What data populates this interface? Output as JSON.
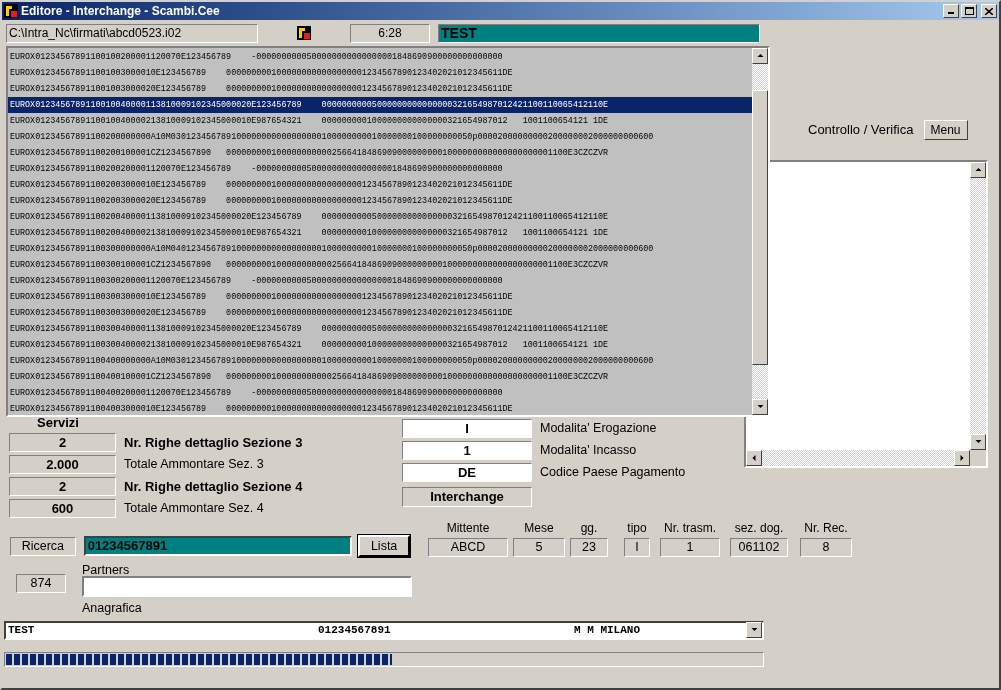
{
  "window": {
    "title": "Editore - Interchange - Scambi.Cee"
  },
  "toolbar": {
    "path": "C:\\Intra_Nc\\firmati\\abcd0523.i02",
    "time": "6:28",
    "status": "TEST"
  },
  "records": [
    {
      "text": "EUROX01234567891100100200001120070E123456789    -0000000000500000000000000001848690900000000000000",
      "selected": false
    },
    {
      "text": "EUROX012345678911001003000010E123456789    0000000001000000000000000001234567890123402021012345611DE",
      "selected": false
    },
    {
      "text": "EUROX012345678911001003000020E123456789    0000000001000000000000000001234567890123402021012345611DE",
      "selected": false
    },
    {
      "text": "EUROX0123456789110010040000113810009102345000020E123456789    00000000005000000000000000321654987012421100110065412110E",
      "selected": true
    },
    {
      "text": "EUROX0123456789110010040000213810009102345000010E987654321    0000000001000000000000000321654987012   1001100654121 1DE",
      "selected": false
    },
    {
      "text": "EUROX01234567891100200000000A10M030123456789100000000000000000100000000010000000100000000050p00002000000000200000002000000000600",
      "selected": false
    },
    {
      "text": "EUROX01234567891100200100001CZ1234567890   00000000010000000000025664184869090000000001000000000000000000001100E3CZCZVR",
      "selected": false
    },
    {
      "text": "EUROX01234567891100200200001120070E123456789    -0000000000500000000000000001848690900000000000000",
      "selected": false
    },
    {
      "text": "EUROX012345678911002003000010E123456789    0000000001000000000000000001234567890123402021012345611DE",
      "selected": false
    },
    {
      "text": "EUROX012345678911002003000020E123456789    0000000001000000000000000001234567890123402021012345611DE",
      "selected": false
    },
    {
      "text": "EUROX0123456789110020040000113810009102345000020E123456789    00000000005000000000000000321654987012421100110065412110E",
      "selected": false
    },
    {
      "text": "EUROX0123456789110020040000213810009102345000010E987654321    0000000001000000000000000321654987012   1001100654121 1DE",
      "selected": false
    },
    {
      "text": "EUROX01234567891100300000000A10M040123456789100000000000000000100000000010000000100000000050p00002000000000200000002000000000600",
      "selected": false
    },
    {
      "text": "EUROX01234567891100300100001CZ1234567890   00000000010000000000025664184869090000000001000000000000000000001100E3CZCZVR",
      "selected": false
    },
    {
      "text": "EUROX01234567891100300200001120070E123456789    -0000000000500000000000000001848690900000000000000",
      "selected": false
    },
    {
      "text": "EUROX012345678911003003000010E123456789    0000000001000000000000000001234567890123402021012345611DE",
      "selected": false
    },
    {
      "text": "EUROX012345678911003003000020E123456789    0000000001000000000000000001234567890123402021012345611DE",
      "selected": false
    },
    {
      "text": "EUROX0123456789110030040000113810009102345000020E123456789    00000000005000000000000000321654987012421100110065412110E",
      "selected": false
    },
    {
      "text": "EUROX0123456789110030040000213810009102345000010E987654321    0000000001000000000000000321654987012   1001100654121 1DE",
      "selected": false
    },
    {
      "text": "EUROX01234567891100400000000A10M030123456789100000000000000000100000000010000000100000000050p00002000000000200000002000000000600",
      "selected": false
    },
    {
      "text": "EUROX01234567891100400100001CZ1234567890   00000000010000000000025664184869090000000001000000000000000000001100E3CZCZVR",
      "selected": false
    },
    {
      "text": "EUROX01234567891100400200001120070E123456789    -0000000000500000000000000001848690900000000000000",
      "selected": false
    },
    {
      "text": "EUROX012345678911004003000010E123456789    0000000001000000000000000001234567890123402021012345611DE",
      "selected": false
    }
  ],
  "verification": {
    "label": "Controllo / Verifica",
    "menu_button": "Menu"
  },
  "servizi": {
    "title": "Servizi",
    "rows": [
      {
        "value": "2",
        "label": "Nr. Righe dettaglio Sezione 3",
        "kind": "count"
      },
      {
        "value": "2.000",
        "label": "Totale Ammontare Sez. 3",
        "kind": "total"
      },
      {
        "value": "2",
        "label": "Nr. Righe dettaglio Sezione 4",
        "kind": "count"
      },
      {
        "value": "600",
        "label": "Totale Ammontare Sez. 4",
        "kind": "total"
      }
    ]
  },
  "payment": {
    "rows": [
      {
        "value": "I",
        "label": "Modalita' Erogazione"
      },
      {
        "value": "1",
        "label": "Modalita' Incasso"
      },
      {
        "value": "DE",
        "label": "Codice Paese Pagamento"
      }
    ],
    "badge": "Interchange"
  },
  "search": {
    "label": "Ricerca",
    "value": "01234567891",
    "button": "Lista"
  },
  "header_fields": [
    {
      "label": "Mittente",
      "value": "ABCD"
    },
    {
      "label": "Mese",
      "value": "5"
    },
    {
      "label": "gg.",
      "value": "23"
    },
    {
      "label": "tipo",
      "value": "I"
    },
    {
      "label": "Nr. trasm.",
      "value": "1"
    },
    {
      "label": "sez. dog.",
      "value": "061102"
    },
    {
      "label": "Nr. Rec.",
      "value": "8"
    }
  ],
  "partners": {
    "count": "874",
    "label": "Partners",
    "caption": "Anagrafica"
  },
  "combo": {
    "columns": [
      "TEST",
      "01234567891",
      "M M MILANO"
    ]
  },
  "progress": {
    "level": 0.51
  }
}
